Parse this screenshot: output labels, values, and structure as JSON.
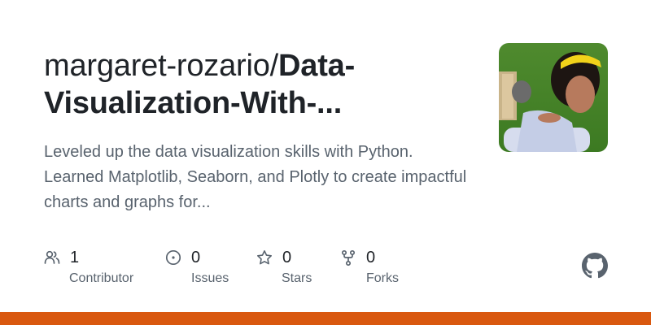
{
  "repo": {
    "owner_prefix": "margaret-rozario/",
    "name_line1": "Data-",
    "name_line2": "Visualization-With-...",
    "description": "Leveled up the data visualization skills with Python. Learned Matplotlib, Seaborn, and Plotly to create impactful charts and graphs for..."
  },
  "stats": {
    "contributors": {
      "value": "1",
      "label": "Contributor",
      "icon": "people-icon"
    },
    "issues": {
      "value": "0",
      "label": "Issues",
      "icon": "issue-circle-icon"
    },
    "stars": {
      "value": "0",
      "label": "Stars",
      "icon": "star-icon"
    },
    "forks": {
      "value": "0",
      "label": "Forks",
      "icon": "fork-icon"
    }
  },
  "brand": {
    "icon": "github-logo-icon",
    "logo_color": "#59636e"
  },
  "colors": {
    "bottom_bar": "#d9580f",
    "text_primary": "#1f2328",
    "text_muted": "#59636e"
  }
}
